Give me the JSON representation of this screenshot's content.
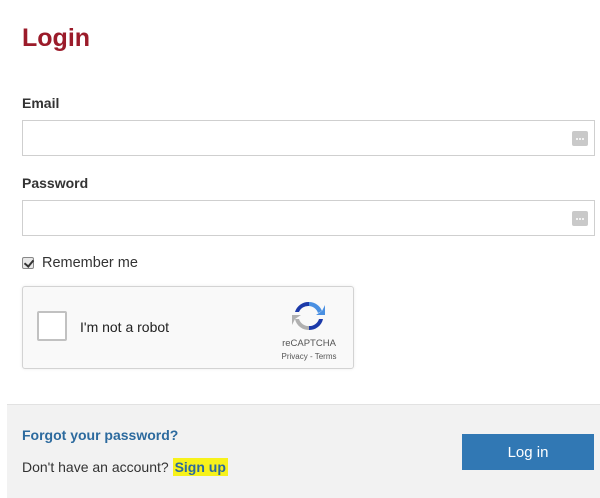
{
  "page": {
    "title": "Login",
    "title_color": "#9b1b2a"
  },
  "form": {
    "email_label": "Email",
    "email_value": "",
    "password_label": "Password",
    "password_value": "",
    "password_manager_icon": "more-dots-icon",
    "remember_label": "Remember me",
    "remember_checked": true
  },
  "recaptcha": {
    "label": "I'm not a robot",
    "brand": "reCAPTCHA",
    "links": "Privacy - Terms"
  },
  "footer": {
    "forgot_label": "Forgot your password?",
    "signup_prompt": "Don't have an account?",
    "signup_label": "Sign up",
    "signup_highlight": "#f7f21b",
    "login_label": "Log in",
    "link_color": "#2c6a9e",
    "button_color": "#3178b4"
  }
}
